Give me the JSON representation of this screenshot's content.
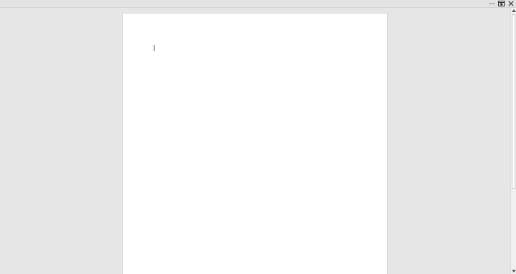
{
  "window": {
    "controls": {
      "more_icon": "more-icon",
      "restore_icon": "restore-icon",
      "close_icon": "close-icon"
    }
  },
  "document": {
    "text": ""
  },
  "scrollbar": {
    "position_fraction": 0.0
  },
  "colors": {
    "background": "#e6e6e6",
    "page": "#ffffff"
  }
}
